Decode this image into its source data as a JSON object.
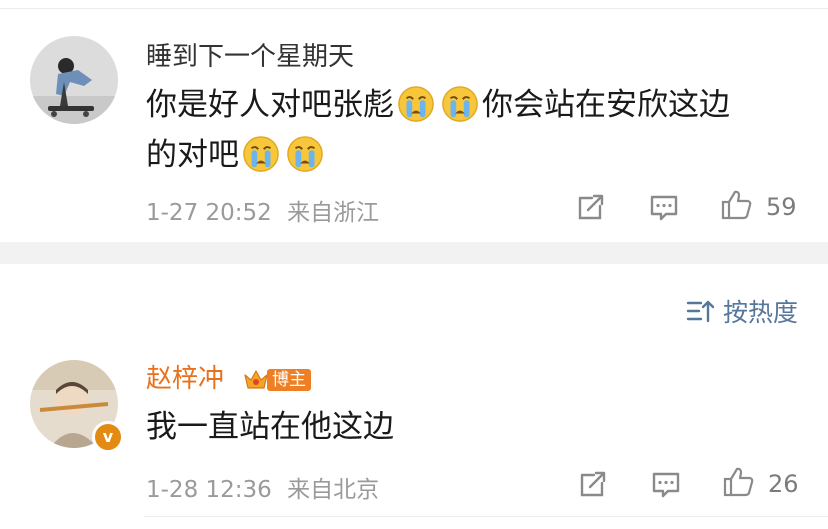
{
  "comments": [
    {
      "username": "睡到下一个星期天",
      "text_part1": "你是好人对吧张彪",
      "text_part2": "你会站在安欣这边",
      "text_part3": "的对吧",
      "emoji_icon": "crying-face-emoji",
      "timestamp": "1-27 20:52",
      "location": "来自浙江",
      "likes": "59"
    },
    {
      "username": "赵梓冲",
      "badge_label": "博主",
      "verified_mark": "v",
      "text": "我一直站在他这边",
      "timestamp": "1-28 12:36",
      "location": "来自北京",
      "likes": "26"
    }
  ],
  "sort": {
    "label": "按热度"
  },
  "colors": {
    "username_highlight": "#e8711c",
    "username_normal": "#333333",
    "sort_blue": "#56779c",
    "meta_gray": "#9a9a9a"
  }
}
